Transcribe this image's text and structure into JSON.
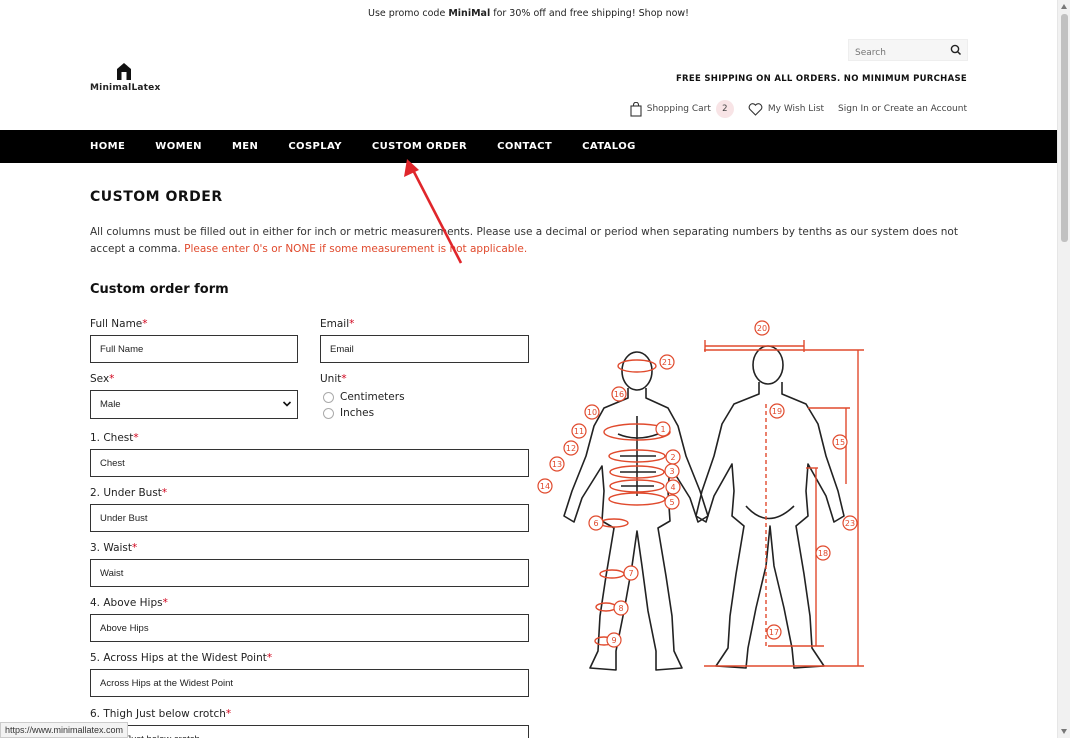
{
  "promo": {
    "prefix": "Use promo code",
    "code": "MiniMal",
    "suffix": " for 30% off and free shipping! Shop now!"
  },
  "search": {
    "placeholder": "Search"
  },
  "logo": {
    "text": "MinimalLatex"
  },
  "free_shipping": "FREE SHIPPING ON ALL ORDERS. NO MINIMUM PURCHASE",
  "utility": {
    "cart_label": "Shopping Cart",
    "cart_count": "2",
    "wishlist_label": "My Wish List",
    "account_label": "Sign In or Create an Account"
  },
  "nav": {
    "items": [
      "HOME",
      "WOMEN",
      "MEN",
      "COSPLAY",
      "CUSTOM ORDER",
      "CONTACT",
      "CATALOG"
    ]
  },
  "page": {
    "title": "CUSTOM ORDER",
    "intro": "All columns must be filled out in either for inch or metric measurements. Please use a decimal or period when separating numbers by tenths as our system does not accept a comma. ",
    "intro_warning": "Please enter 0's or NONE if some measurement is not applicable."
  },
  "form": {
    "title": "Custom order form",
    "required_mark": "*",
    "full_name": {
      "label": "Full Name",
      "placeholder": "Full Name"
    },
    "email": {
      "label": "Email",
      "placeholder": "Email"
    },
    "sex": {
      "label": "Sex",
      "selected": "Male"
    },
    "unit": {
      "label": "Unit",
      "options": [
        "Centimeters",
        "Inches"
      ]
    },
    "chest": {
      "label": "1. Chest",
      "placeholder": "Chest"
    },
    "under_bust": {
      "label": "2. Under Bust",
      "placeholder": "Under Bust"
    },
    "waist": {
      "label": "3. Waist",
      "placeholder": "Waist"
    },
    "above_hips": {
      "label": "4. Above Hips",
      "placeholder": "Above Hips"
    },
    "across_hips": {
      "label": "5. Across Hips at the Widest Point",
      "placeholder": "Across Hips at the Widest Point"
    },
    "thigh": {
      "label": "6. Thigh Just below crotch",
      "placeholder": "Thigh Just below crotch"
    }
  },
  "diagram": {
    "markers": [
      "1",
      "2",
      "3",
      "4",
      "5",
      "6",
      "7",
      "8",
      "9",
      "10",
      "11",
      "12",
      "13",
      "14",
      "15",
      "16",
      "17",
      "18",
      "19",
      "20",
      "21",
      "23"
    ]
  },
  "status_bar": {
    "url": "https://www.minimallatex.com"
  },
  "colors": {
    "accent": "#e04a2d",
    "nav_bg": "#000000",
    "badge_bg": "#f8e4e6"
  }
}
